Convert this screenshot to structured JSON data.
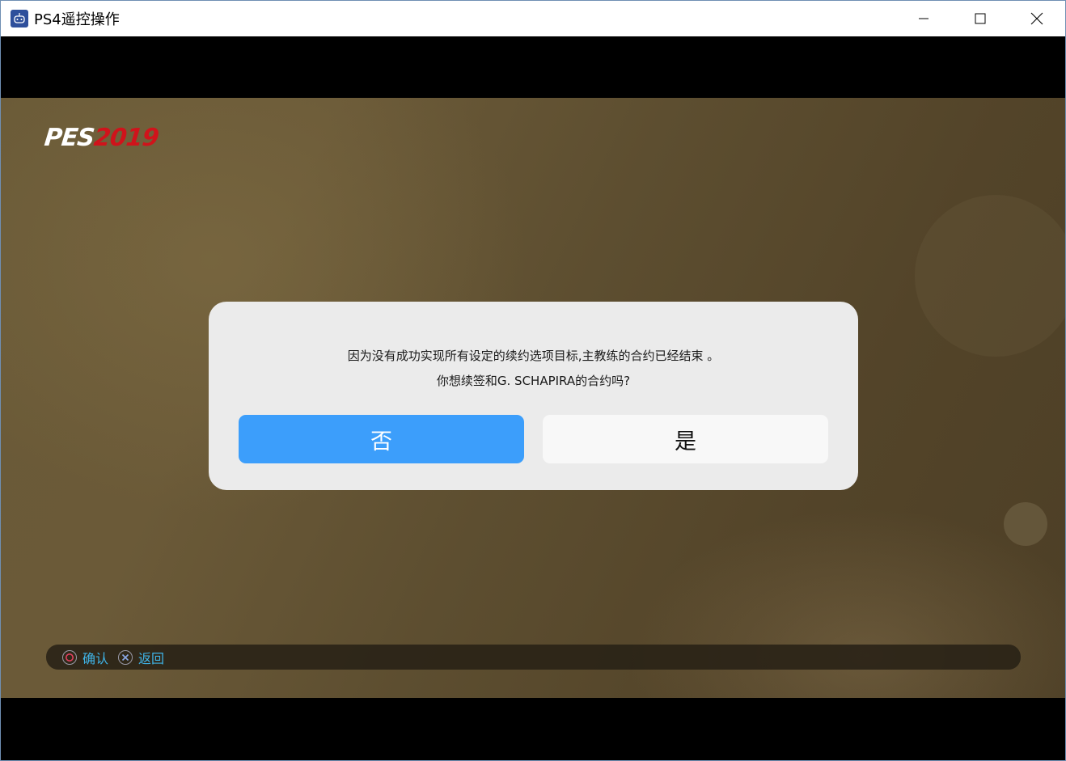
{
  "window": {
    "title": "PS4遥控操作",
    "icon": "remote-play-app-icon",
    "controls": [
      "minimize-icon",
      "maximize-icon",
      "close-icon"
    ]
  },
  "game": {
    "logo_left": "PES",
    "logo_right": "2019"
  },
  "dialog": {
    "line1": "因为没有成功实现所有设定的续约选项目标,主教练的合约已经结束 。",
    "line2": "你想续签和G. SCHAPIRA的合约吗?",
    "no_label": "否",
    "yes_label": "是",
    "focused": "no"
  },
  "hints": [
    {
      "icon": "circle-button-icon",
      "label": "确认"
    },
    {
      "icon": "cross-button-icon",
      "label": "返回"
    }
  ],
  "colors": {
    "focus_button": "#3c9efb",
    "hint_text": "#3fb4e8",
    "logo_red": "#d0131b"
  }
}
